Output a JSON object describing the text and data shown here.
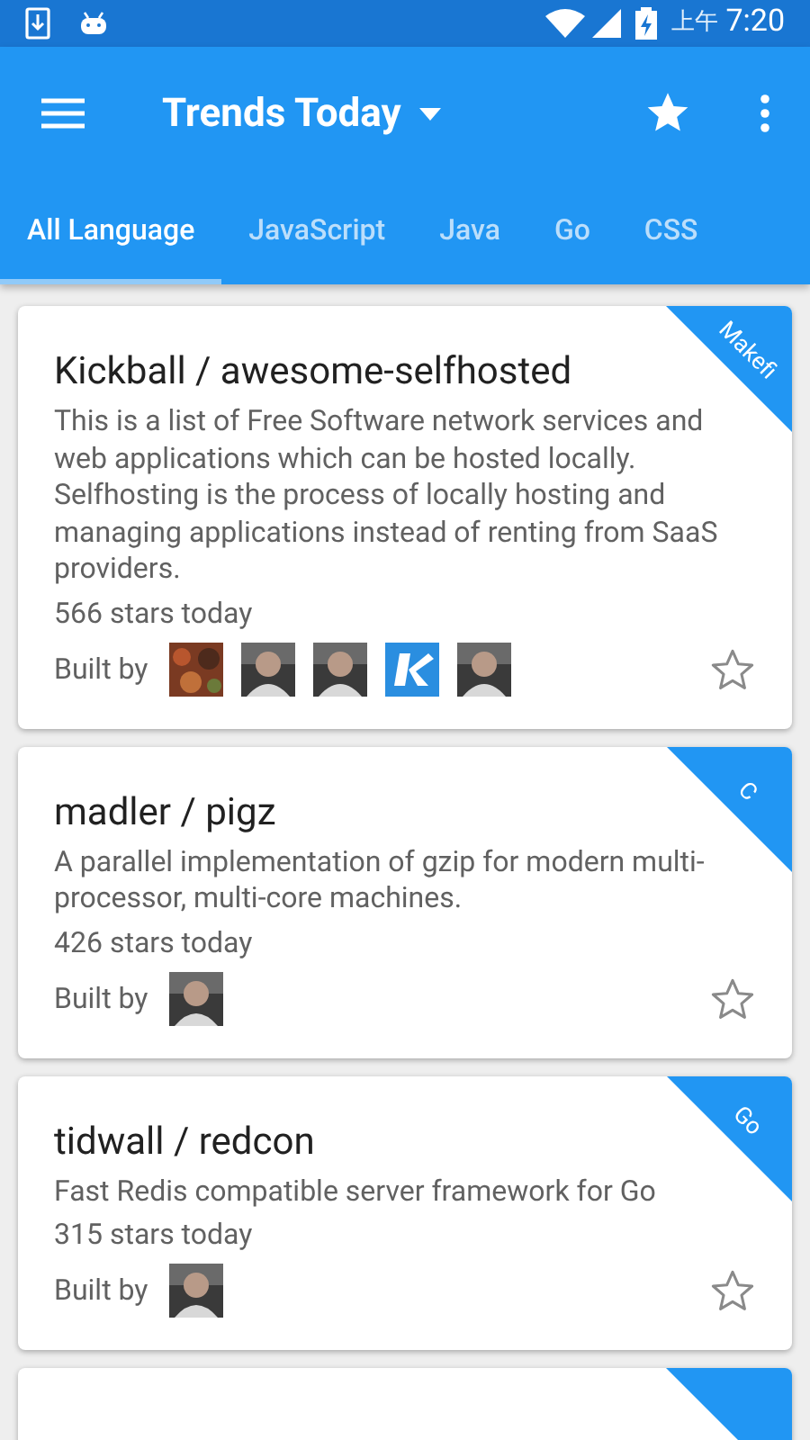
{
  "status_bar": {
    "period": "上午",
    "time": "7:20"
  },
  "toolbar": {
    "title": "Trends Today"
  },
  "tabs": [
    {
      "label": "All Language",
      "selected": true
    },
    {
      "label": "JavaScript",
      "selected": false
    },
    {
      "label": "Java",
      "selected": false
    },
    {
      "label": "Go",
      "selected": false
    },
    {
      "label": "CSS",
      "selected": false
    }
  ],
  "repos": [
    {
      "name": "Kickball / awesome-selfhosted",
      "description": "This is a list of Free Software network services and web applications which can be hosted locally. Selfhosting is the process of locally hosting and managing applications instead of renting from SaaS providers.",
      "stars_today": "566 stars today",
      "built_by": "Built by",
      "language": "Makefi",
      "contributors": [
        {
          "kind": "pattern"
        },
        {
          "kind": "person"
        },
        {
          "kind": "person"
        },
        {
          "kind": "logo"
        },
        {
          "kind": "person"
        }
      ],
      "starred": false
    },
    {
      "name": "madler / pigz",
      "description": "A parallel implementation of gzip for modern multi-processor, multi-core machines.",
      "stars_today": "426 stars today",
      "built_by": "Built by",
      "language": "C",
      "contributors": [
        {
          "kind": "person"
        }
      ],
      "starred": false
    },
    {
      "name": "tidwall / redcon",
      "description": "Fast Redis compatible server framework for Go",
      "stars_today": "315 stars today",
      "built_by": "Built by",
      "language": "Go",
      "contributors": [
        {
          "kind": "person"
        }
      ],
      "starred": false
    }
  ]
}
